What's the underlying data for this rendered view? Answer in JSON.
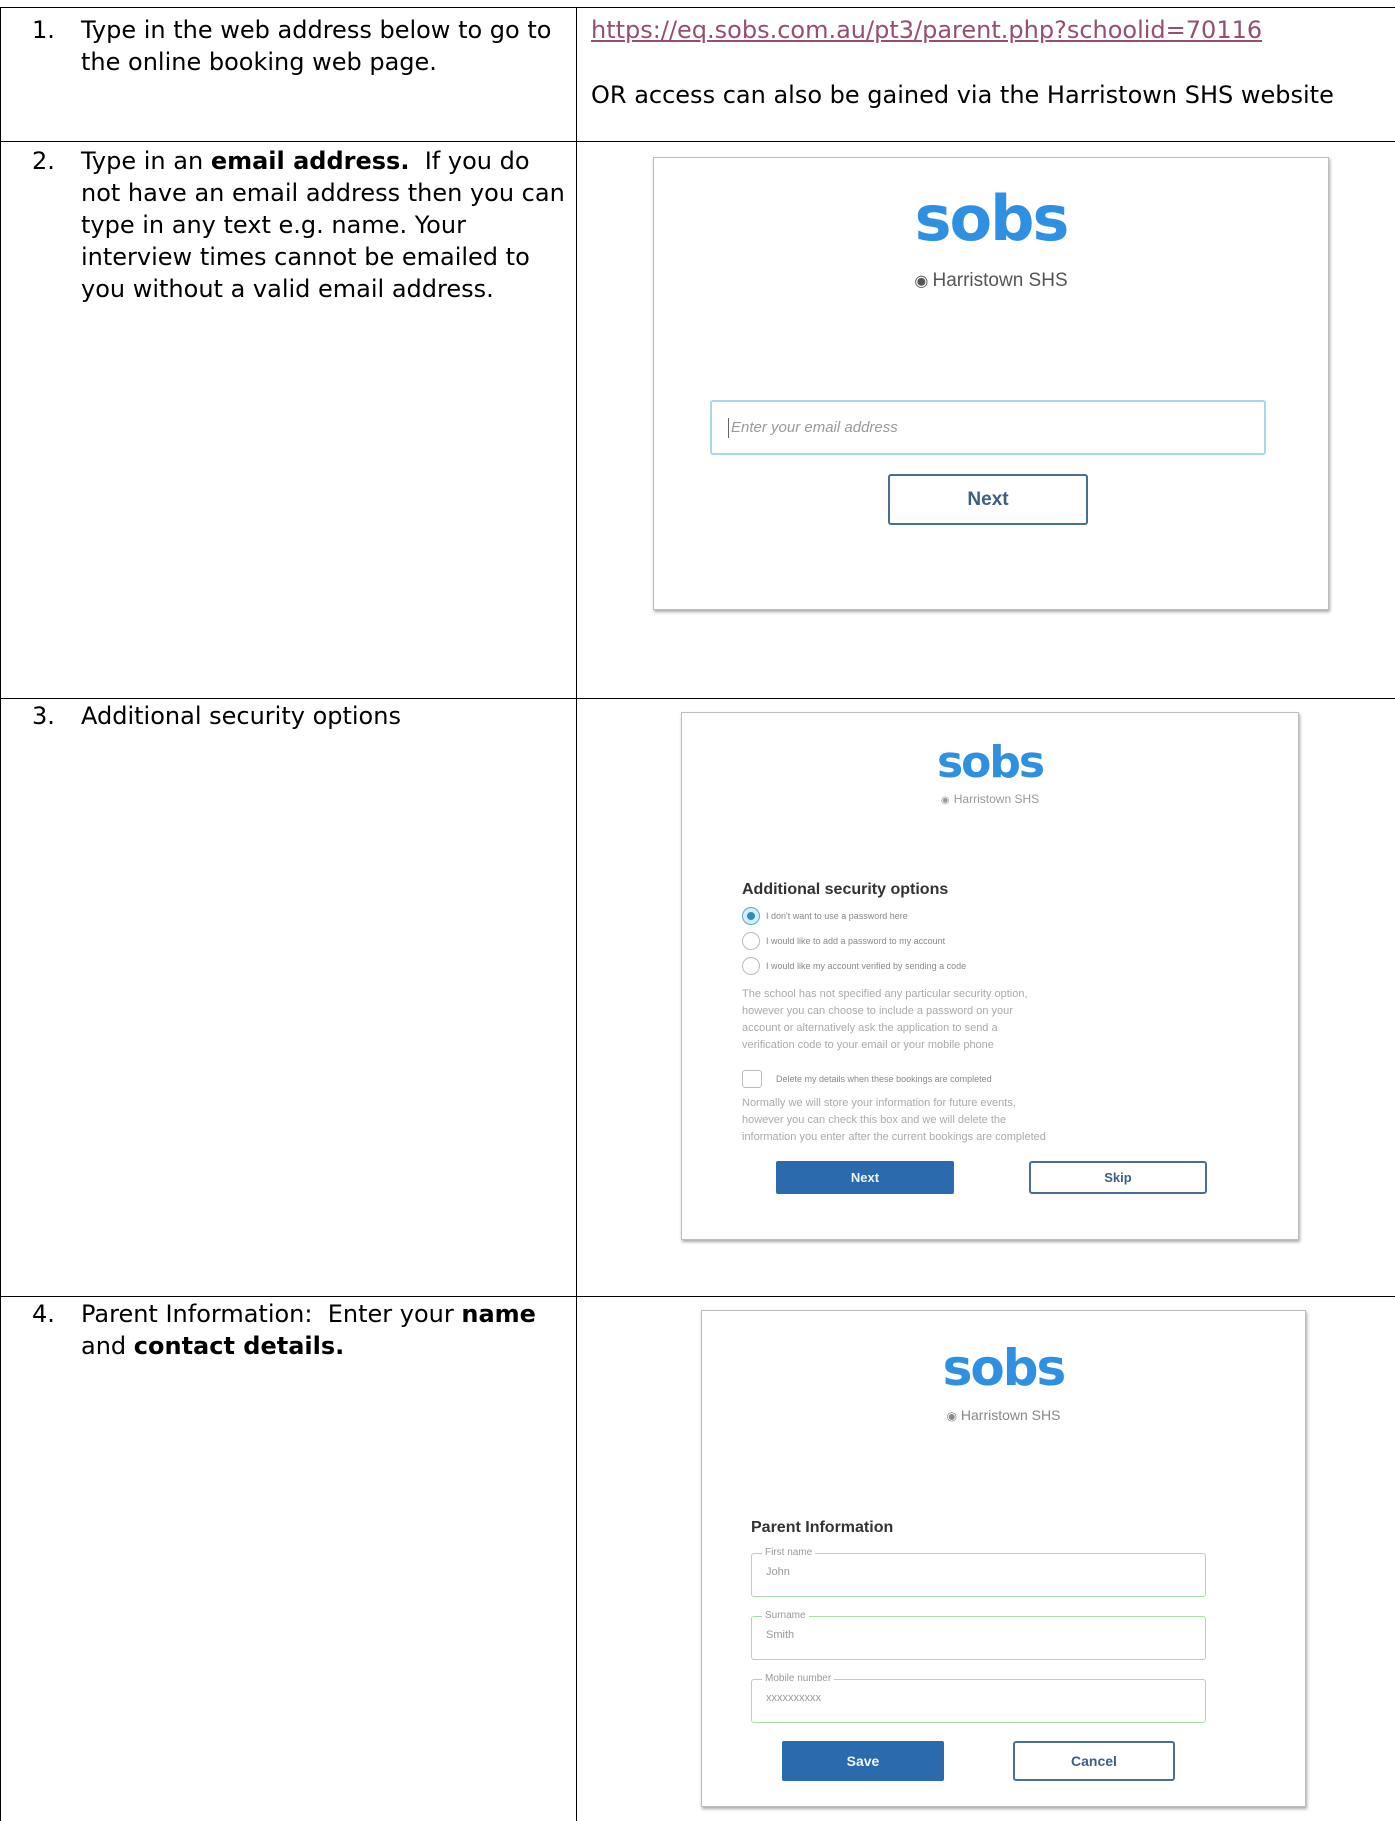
{
  "rows": [
    {
      "number": "1.",
      "instruction_lines": [
        "Type in the web address below to go to",
        "the online booking web page."
      ],
      "link": "https://eq.sobs.com.au/pt3/parent.php?schoolid=70116",
      "alt_text": "OR access can also be gained via the Harristown SHS website"
    },
    {
      "number": "2.",
      "instruction_parts": {
        "pre": "Type in an ",
        "bold": "email address.",
        "post": "  If you do"
      },
      "instruction_lines": [
        "not have an email address then you can",
        "type in any text e.g. name.  Your",
        "interview times cannot be emailed to",
        "you without a valid email address."
      ],
      "screen": {
        "logo": "sobs",
        "school": "Harristown SHS",
        "email_placeholder": "Enter your email address",
        "next_label": "Next"
      }
    },
    {
      "number": "3.",
      "instruction": "Additional security options",
      "screen": {
        "logo": "sobs",
        "school": "Harristown SHS",
        "title": "Additional security options",
        "options": [
          "I don't want to use a password here",
          "I would like to add a password to my account",
          "I would like my account verified by sending a code"
        ],
        "selected_option": 0,
        "description_lines": [
          "The school has not specified any particular security option,",
          "however you can choose to include a password on your",
          "account or alternatively ask the application to send a",
          "verification code to your email or your mobile phone"
        ],
        "delete_label": "Delete my details when these bookings are completed",
        "delete_description_lines": [
          "Normally we will store your information for future events,",
          "however you can check this box and we will delete the",
          "information you enter after the current bookings are completed"
        ],
        "next_label": "Next",
        "skip_label": "Skip"
      }
    },
    {
      "number": "4.",
      "instruction_parts": {
        "pre": "Parent Information:  Enter your ",
        "bold1": "name",
        "mid": "and ",
        "bold2": "contact details."
      },
      "screen": {
        "logo": "sobs",
        "school": "Harristown SHS",
        "title": "Parent Information",
        "fields": [
          {
            "label": "First name",
            "value": "John"
          },
          {
            "label": "Surname",
            "value": "Smith"
          },
          {
            "label": "Mobile number",
            "value": "xxxxxxxxxx"
          }
        ],
        "save_label": "Save",
        "cancel_label": "Cancel"
      }
    }
  ]
}
